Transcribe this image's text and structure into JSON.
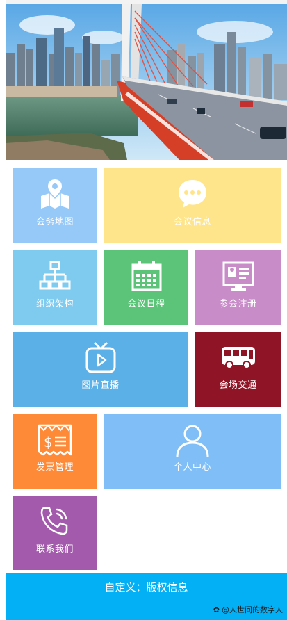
{
  "tiles": [
    {
      "label": "会务地图",
      "icon": "map-icon",
      "color": "#96c8f8"
    },
    {
      "label": "会议信息",
      "icon": "chat-bubble-icon",
      "color": "#fee58c"
    },
    {
      "label": "组织架构",
      "icon": "org-chart-icon",
      "color": "#7fcbf0"
    },
    {
      "label": "会议日程",
      "icon": "calendar-icon",
      "color": "#5cc479"
    },
    {
      "label": "参会注册",
      "icon": "id-card-icon",
      "color": "#c88cc9"
    },
    {
      "label": "图片直播",
      "icon": "tv-play-icon",
      "color": "#5bb0e7"
    },
    {
      "label": "会场交通",
      "icon": "bus-icon",
      "color": "#8f1426"
    },
    {
      "label": "发票管理",
      "icon": "invoice-icon",
      "color": "#fe8a38"
    },
    {
      "label": "个人中心",
      "icon": "user-icon",
      "color": "#7fbef6"
    },
    {
      "label": "联系我们",
      "icon": "phone-icon",
      "color": "#a45aac"
    }
  ],
  "footer": {
    "text": "自定义：版权信息",
    "color": "#03b0f5"
  },
  "watermark": {
    "text": "@人世间的数字人"
  }
}
